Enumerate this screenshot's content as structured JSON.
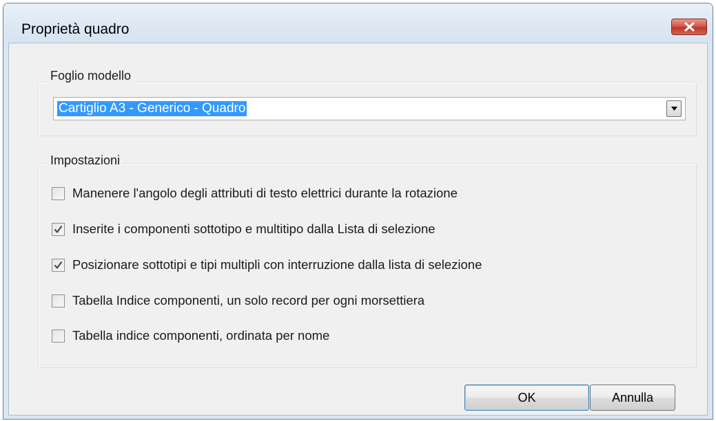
{
  "window": {
    "title": "Proprietà quadro",
    "close_icon": "close-x-icon"
  },
  "template_group": {
    "label": "Foglio modello",
    "selected_value": "Cartiglio A3 - Generico - Quadro",
    "dropdown_icon": "chevron-down-icon"
  },
  "settings_group": {
    "label": "Impostazioni",
    "options": [
      {
        "label": "Manenere l'angolo degli attributi di testo elettrici durante la rotazione",
        "checked": false
      },
      {
        "label": "Inserite i componenti sottotipo e  multitipo dalla Lista di selezione",
        "checked": true
      },
      {
        "label": "Posizionare sottotipi e tipi multipli con interruzione dalla lista di selezione",
        "checked": true
      },
      {
        "label": "Tabella Indice componenti, un solo record per ogni morsettiera",
        "checked": false
      },
      {
        "label": "Tabella indice componenti, ordinata per nome",
        "checked": false
      }
    ]
  },
  "buttons": {
    "ok_label": "OK",
    "cancel_label": "Annulla"
  },
  "colors": {
    "selection": "#3399ff",
    "close_button": "#c1362a",
    "dialog_background": "#f0f0f0",
    "frame": "#dbe6f3"
  }
}
